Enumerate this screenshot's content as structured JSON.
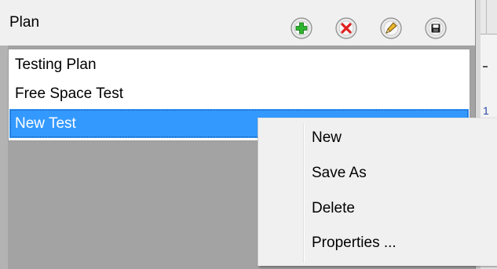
{
  "panel": {
    "title": "Plan",
    "toolbar": [
      {
        "icon": "add-icon",
        "label": "Add",
        "color": "#19a319"
      },
      {
        "icon": "delete-icon",
        "label": "Delete",
        "color": "#e02020"
      },
      {
        "icon": "edit-icon",
        "label": "Edit",
        "color": "#d4a017"
      },
      {
        "icon": "save-icon",
        "label": "Save",
        "color": "#1a1a1a"
      }
    ]
  },
  "list": {
    "items": [
      "Testing Plan",
      "Free Space Test",
      "New Test"
    ],
    "selected_index": 2
  },
  "right_pane": {
    "number": "1"
  },
  "context_menu": {
    "items": [
      "New",
      "Save As",
      "Delete",
      "Properties ..."
    ]
  },
  "colors": {
    "selection": "#3399ff",
    "panel_background": "#a3a3a3",
    "menu_background": "#f0f0f0"
  }
}
